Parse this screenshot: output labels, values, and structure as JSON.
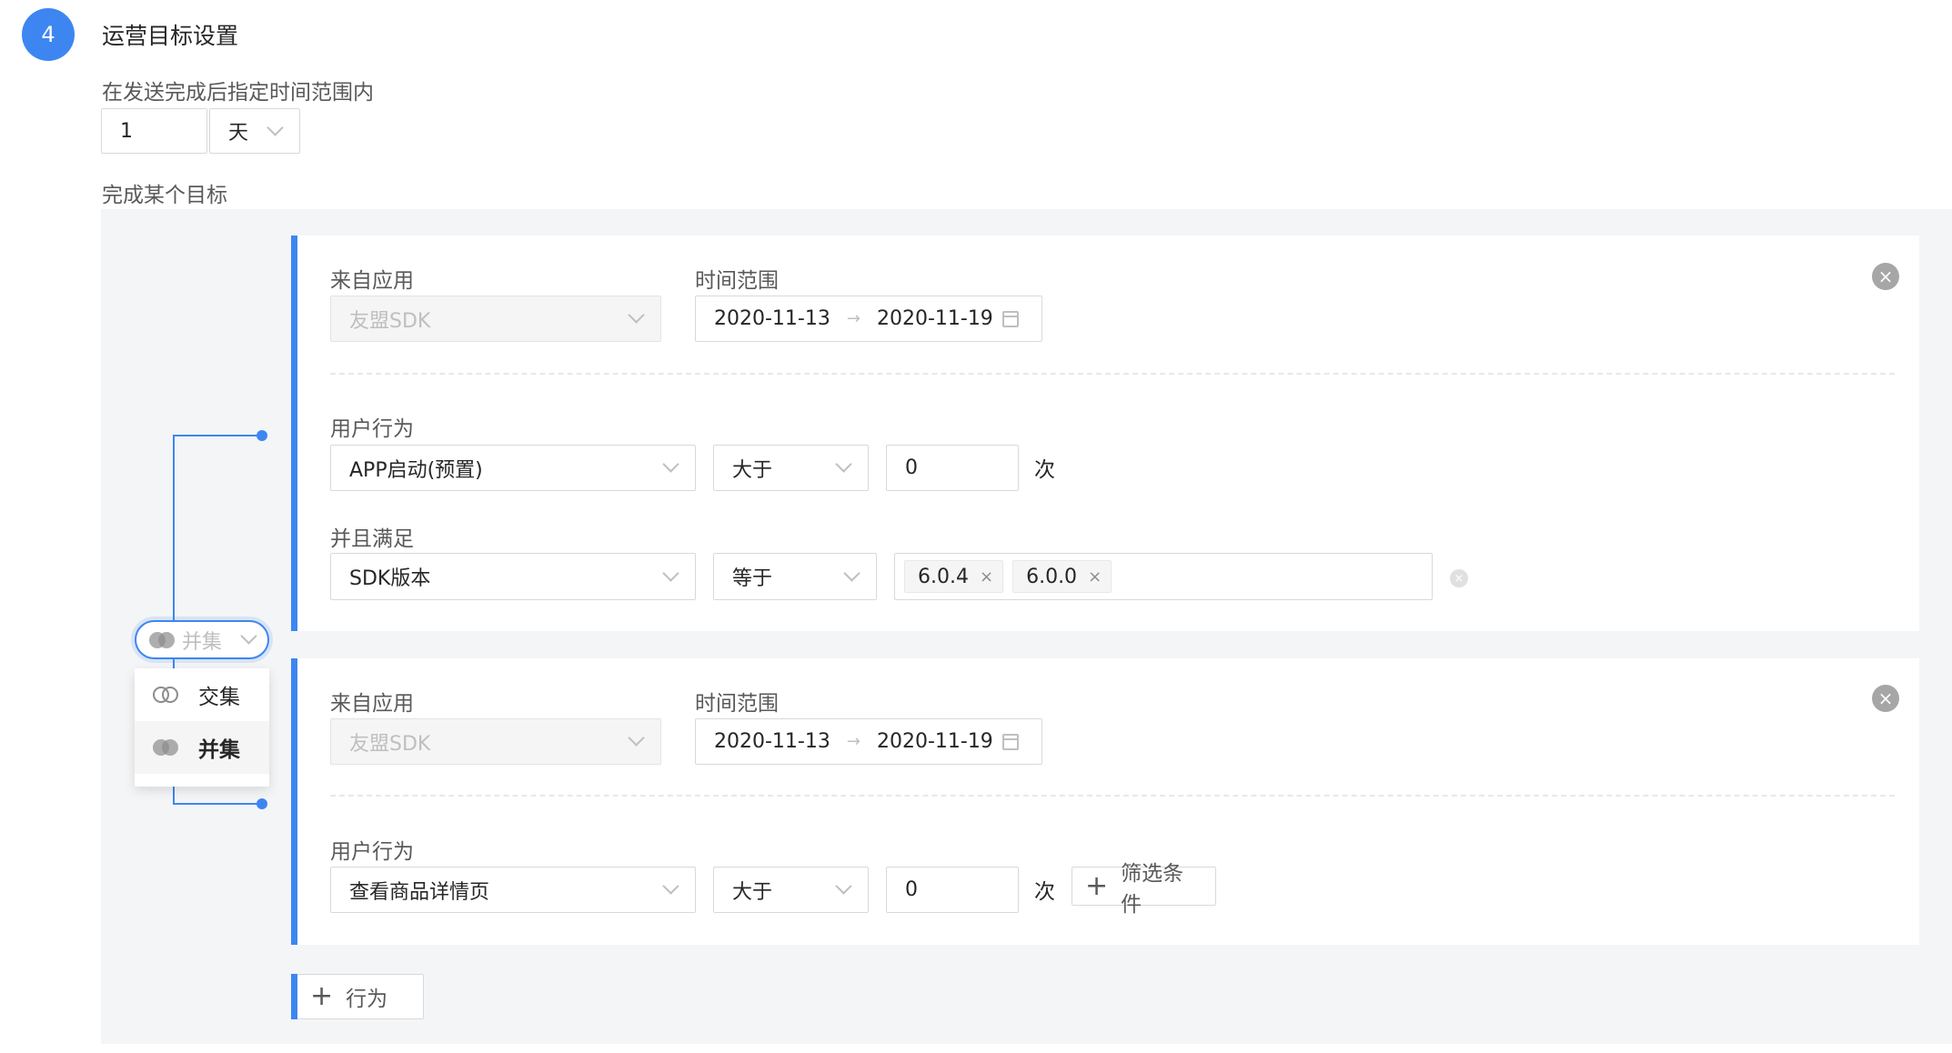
{
  "step": {
    "number": "4",
    "title": "运营目标设置"
  },
  "window_label": "在发送完成后指定时间范围内",
  "window_value": "1",
  "window_unit": "天",
  "goal_label": "完成某个目标",
  "logic": {
    "selected": "并集",
    "options": [
      "交集",
      "并集"
    ]
  },
  "blocks": [
    {
      "app_label": "来自应用",
      "app_value": "友盟SDK",
      "time_label": "时间范围",
      "date_start": "2020-11-13",
      "date_end": "2020-11-19",
      "behavior_label": "用户行为",
      "behavior_value": "APP启动(预置)",
      "op_value": "大于",
      "count_value": "0",
      "count_unit": "次",
      "filter": {
        "label": "并且满足",
        "field": "SDK版本",
        "op": "等于",
        "tags": [
          "6.0.4",
          "6.0.0"
        ]
      }
    },
    {
      "app_label": "来自应用",
      "app_value": "友盟SDK",
      "time_label": "时间范围",
      "date_start": "2020-11-13",
      "date_end": "2020-11-19",
      "behavior_label": "用户行为",
      "behavior_value": "查看商品详情页",
      "op_value": "大于",
      "count_value": "0",
      "count_unit": "次",
      "add_filter_label": "筛选条件"
    }
  ],
  "add_behavior_label": "行为",
  "colors": {
    "primary": "#3d86f2",
    "panel_bg": "#f4f5f7"
  }
}
